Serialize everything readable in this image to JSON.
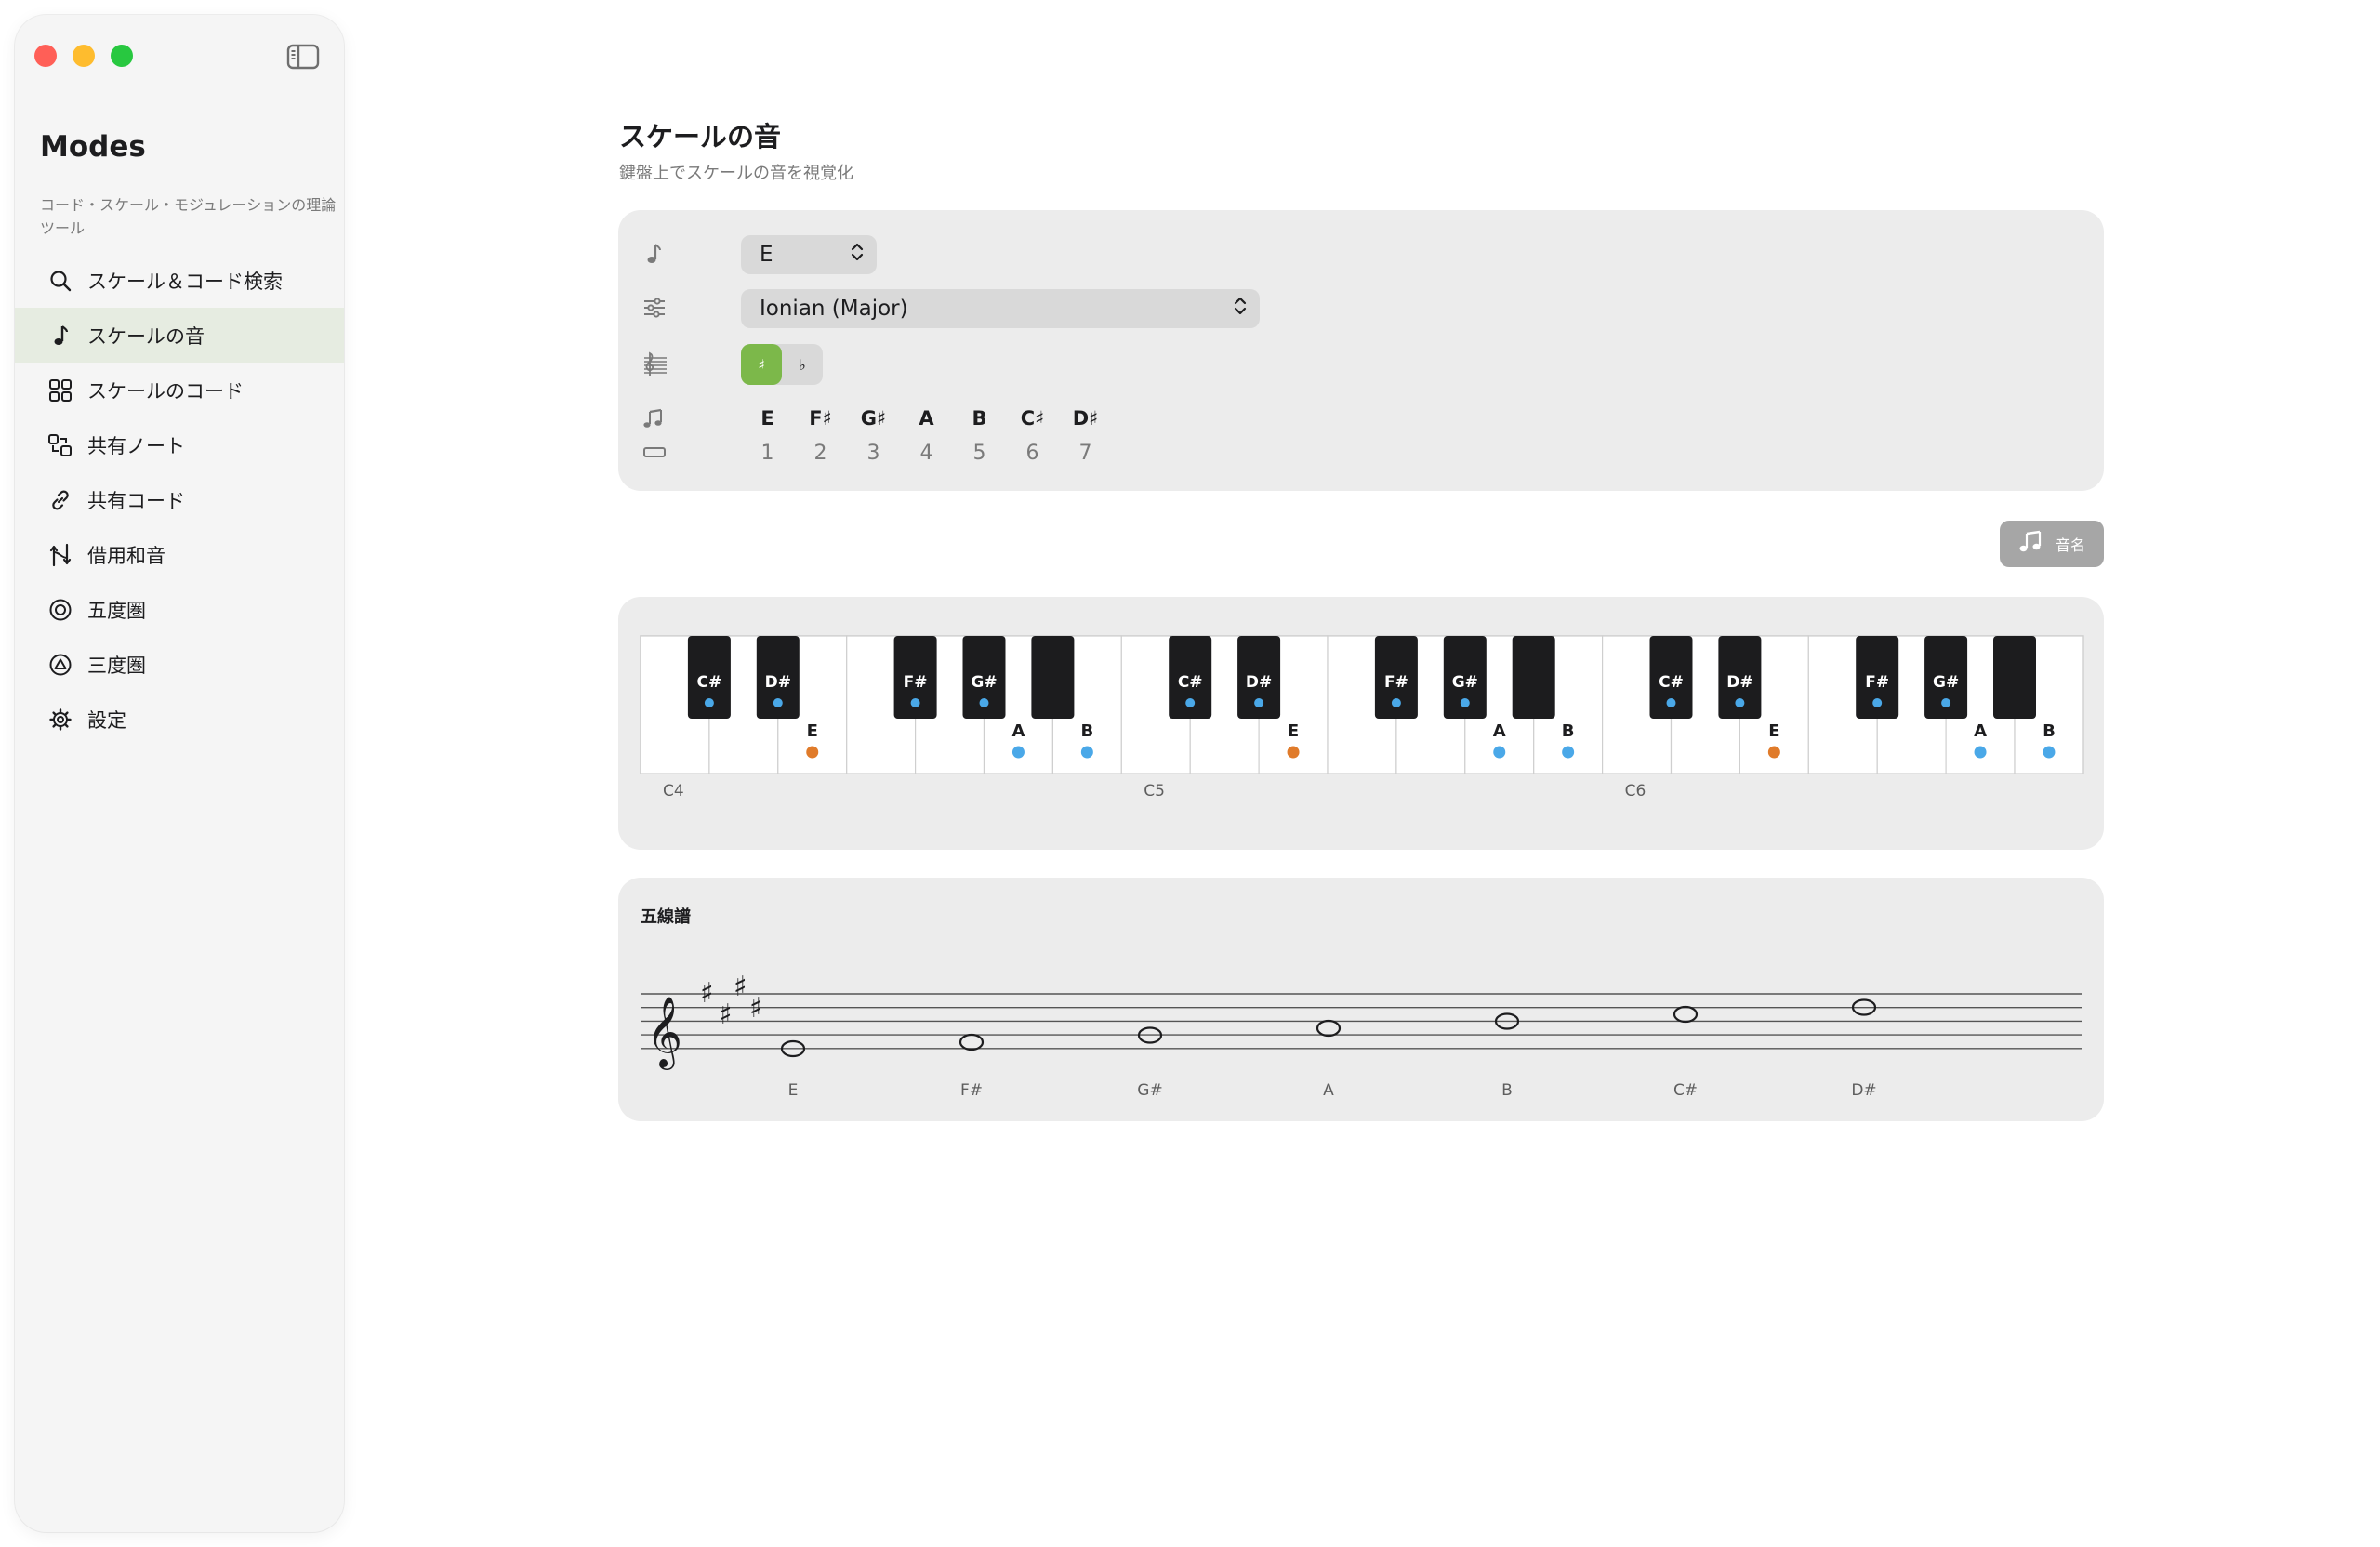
{
  "app": {
    "title": "Modes",
    "subtitle": "コード・スケール・モジュレーションの理論ツール"
  },
  "sidebar": {
    "items": [
      {
        "label": "スケール＆コード検索",
        "icon": "search-icon",
        "active": false
      },
      {
        "label": "スケールの音",
        "icon": "music-note-icon",
        "active": true
      },
      {
        "label": "スケールのコード",
        "icon": "grid-icon",
        "active": false
      },
      {
        "label": "共有ノート",
        "icon": "shared-notes-icon",
        "active": false
      },
      {
        "label": "共有コード",
        "icon": "link-icon",
        "active": false
      },
      {
        "label": "借用和音",
        "icon": "borrowed-chord-icon",
        "active": false
      },
      {
        "label": "五度圏",
        "icon": "circle-of-fifths-icon",
        "active": false
      },
      {
        "label": "三度圏",
        "icon": "circle-of-thirds-icon",
        "active": false
      },
      {
        "label": "設定",
        "icon": "gear-icon",
        "active": false
      }
    ]
  },
  "page": {
    "title": "スケールの音",
    "subtitle": "鍵盤上でスケールの音を視覚化"
  },
  "settings": {
    "root_key": "E",
    "mode": "Ionian (Major)",
    "accidental_options": [
      "♯",
      "♭"
    ],
    "accidental_selected": "♯",
    "scale_notes": [
      "E",
      "F♯",
      "G♯",
      "A",
      "B",
      "C♯",
      "D♯"
    ],
    "scale_degrees": [
      "1",
      "2",
      "3",
      "4",
      "5",
      "6",
      "7"
    ]
  },
  "toolbar": {
    "note_names_label": "音名"
  },
  "piano": {
    "octave_labels": [
      "C4",
      "C5",
      "C6"
    ],
    "white_labels": [
      "",
      "",
      "E",
      "",
      "",
      "A",
      "B"
    ],
    "white_marker_colors": [
      "",
      "",
      "#e07b2a",
      "",
      "",
      "#4aa8e8",
      "#4aa8e8"
    ],
    "black_labels": [
      "C#",
      "D#",
      "F#",
      "G#",
      ""
    ],
    "marker_root_color": "#e07b2a",
    "marker_note_color": "#4aa8e8"
  },
  "staff": {
    "title": "五線譜",
    "key_signature": [
      "♯",
      "♯",
      "♯",
      "♯"
    ],
    "note_labels": [
      "E",
      "F#",
      "G#",
      "A",
      "B",
      "C#",
      "D#"
    ]
  }
}
